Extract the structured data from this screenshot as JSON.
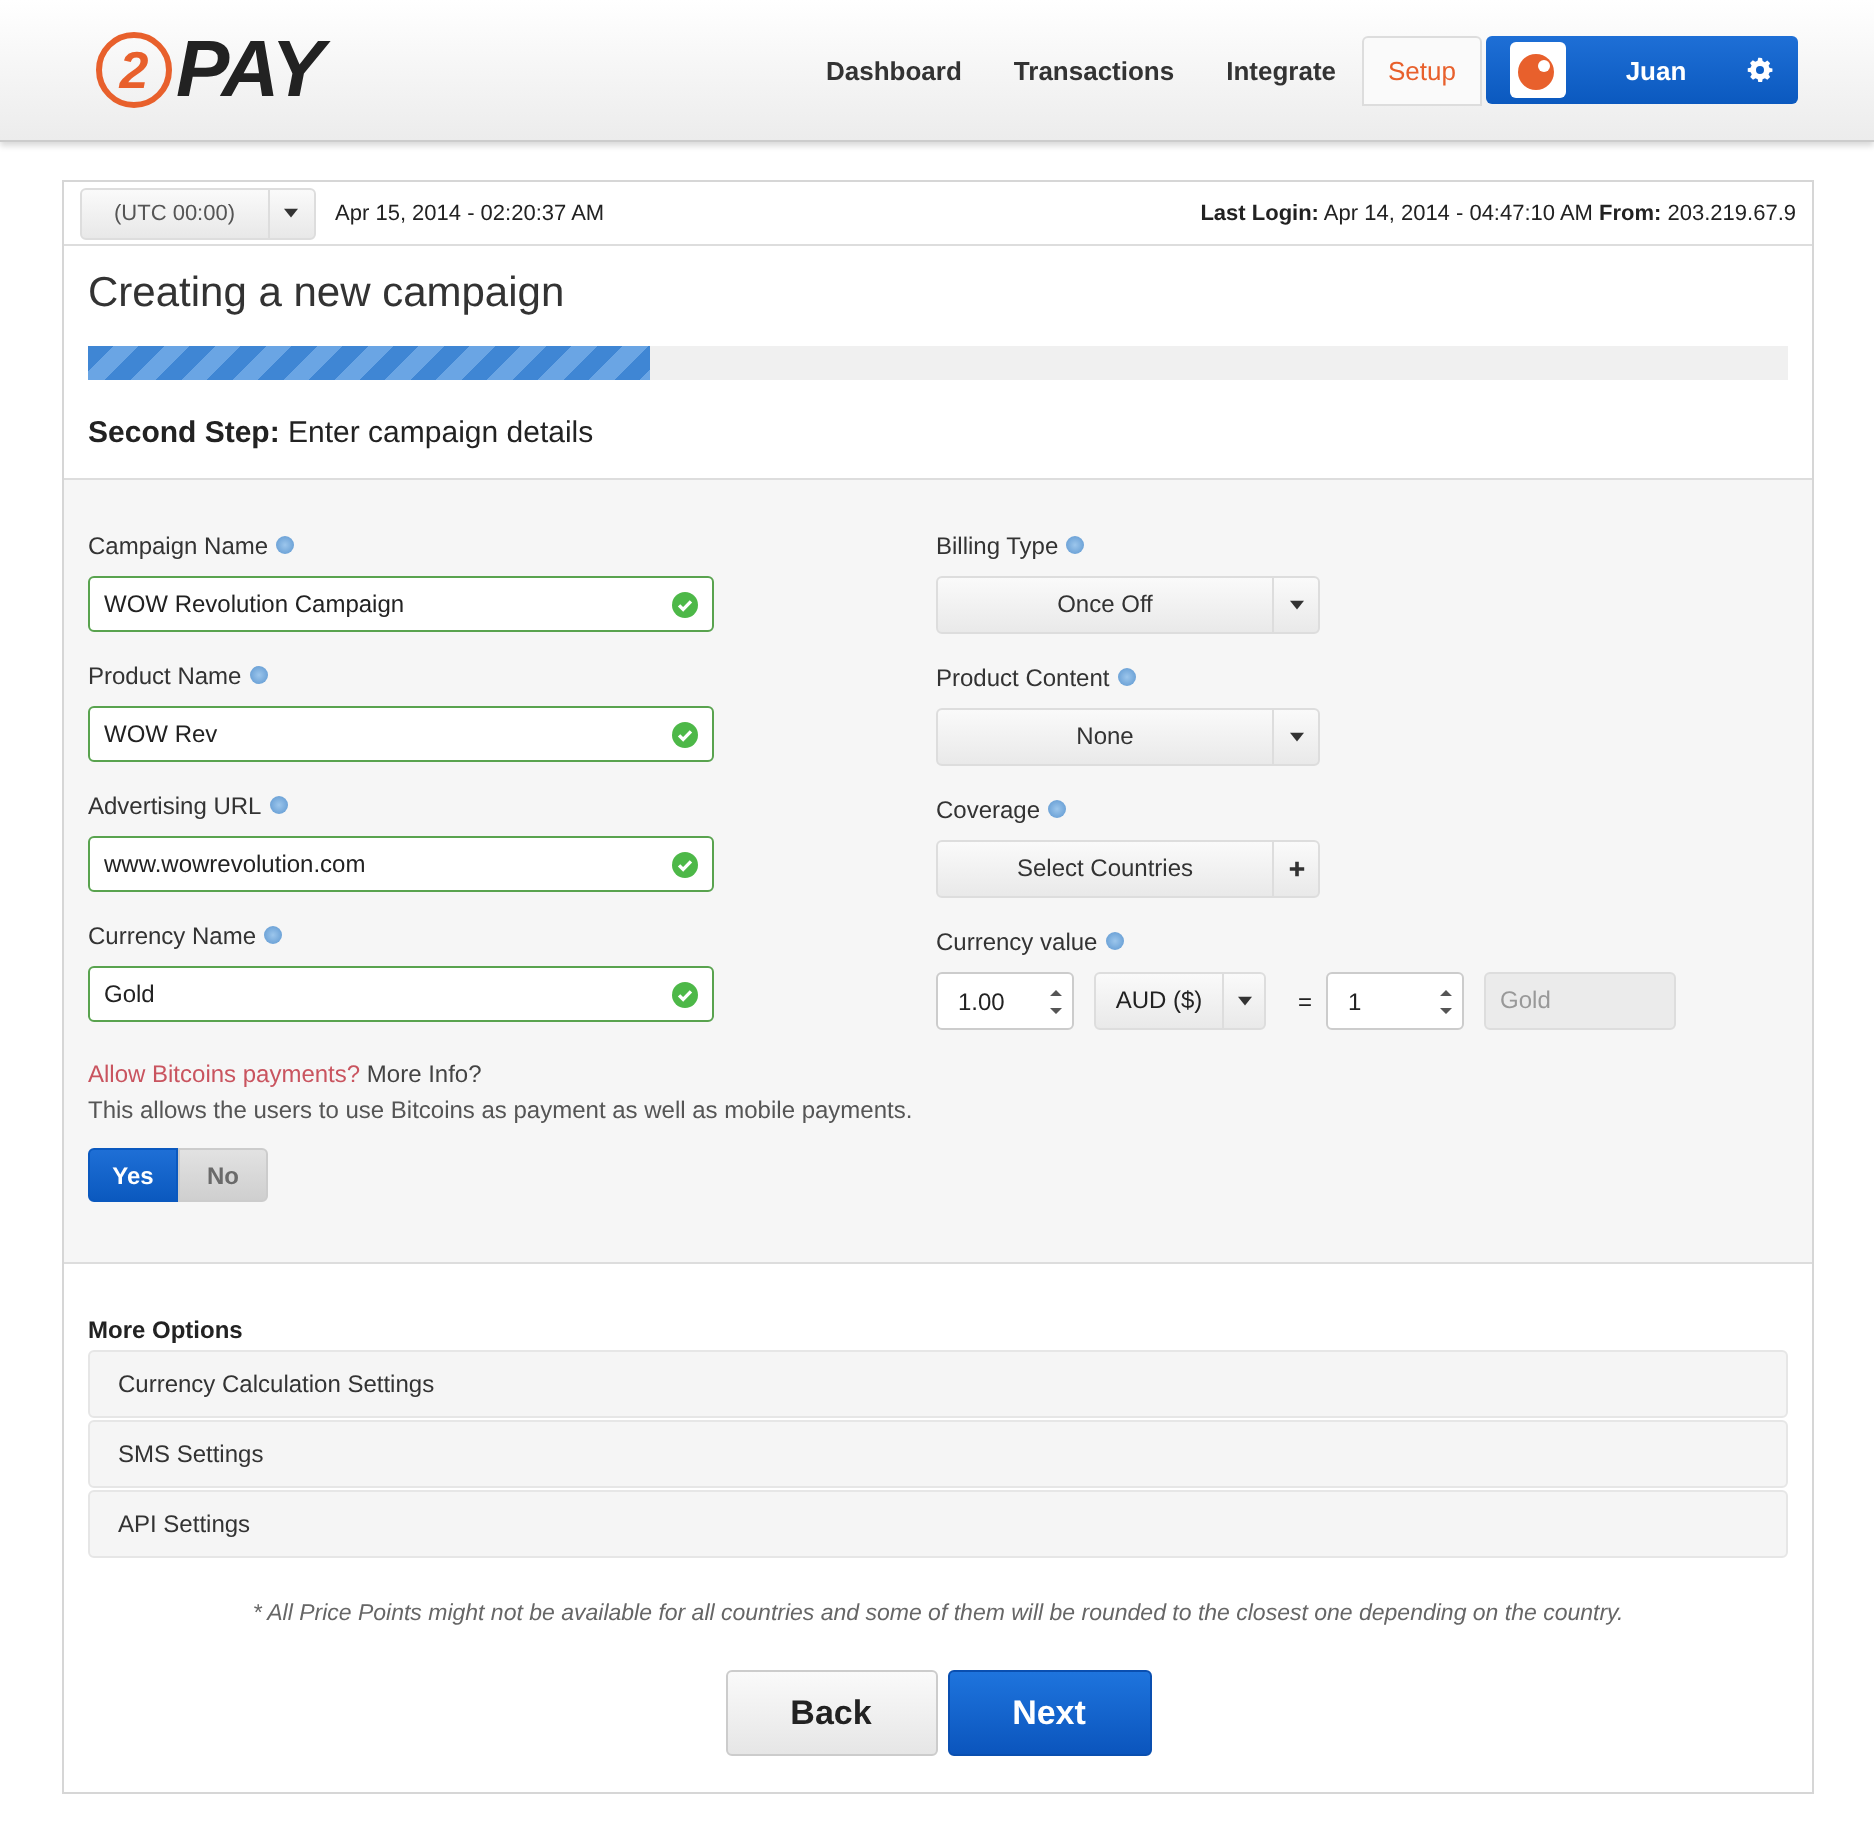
{
  "logo": {
    "mark": "2",
    "text": "PAY"
  },
  "nav": [
    {
      "label": "Dashboard",
      "selected": false
    },
    {
      "label": "Transactions",
      "selected": false
    },
    {
      "label": "Integrate",
      "selected": false
    },
    {
      "label": "Setup",
      "selected": true
    }
  ],
  "user": {
    "name": "Juan"
  },
  "info_bar": {
    "timezone": "(UTC 00:00)",
    "now": "Apr 15, 2014 - 02:20:37 AM",
    "last_login_label": "Last Login:",
    "last_login": "Apr 14, 2014 - 04:47:10 AM",
    "from_label": "From:",
    "from": "203.219.67.9"
  },
  "title": "Creating a new campaign",
  "progress": {
    "level": 0.33
  },
  "step": {
    "label": "Second Step:",
    "text": "Enter campaign details"
  },
  "left_fields": [
    {
      "label": "Campaign Name",
      "value": "WOW Revolution Campaign",
      "valid": true
    },
    {
      "label": "Product Name",
      "value": "WOW Rev",
      "valid": true
    },
    {
      "label": "Advertising URL",
      "value": "www.wowrevolution.com",
      "valid": true
    },
    {
      "label": "Currency Name",
      "value": "Gold",
      "valid": true
    }
  ],
  "right_fields": [
    {
      "label": "Billing Type",
      "kind": "dropdown",
      "value": "Once Off"
    },
    {
      "label": "Product Content",
      "kind": "dropdown",
      "value": "None"
    },
    {
      "label": "Coverage",
      "kind": "add",
      "value": "Select Countries"
    }
  ],
  "currency_value": {
    "label": "Currency value",
    "amount": "1.00",
    "currency": "AUD ($)",
    "equals": "=",
    "units": "1",
    "unit_name": "Gold"
  },
  "bitcoin": {
    "question": "Allow Bitcoins payments?",
    "more": "More Info?",
    "description": "This allows the users to use Bitcoins as payment as well as mobile payments.",
    "options": [
      {
        "label": "Yes",
        "selected": true
      },
      {
        "label": "No",
        "selected": false
      }
    ]
  },
  "more_options": {
    "title": "More Options",
    "items": [
      "Currency Calculation Settings",
      "SMS Settings",
      "API Settings"
    ]
  },
  "footnote": "* All Price Points might not be available for all countries and some of them will be rounded to the closest one depending on the country.",
  "buttons": [
    {
      "label": "Back",
      "kind": "secondary"
    },
    {
      "label": "Next",
      "kind": "primary"
    }
  ]
}
